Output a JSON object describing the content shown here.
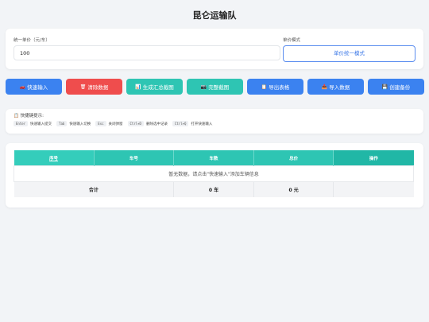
{
  "page": {
    "title": "昆仑运输队"
  },
  "config": {
    "price_label": "统一单价（元/车）",
    "price_value": "100",
    "mode_label": "单价模式",
    "mode_button": "单价统一模式"
  },
  "toolbar": {
    "buttons": [
      {
        "icon": "truck-icon",
        "glyph": "🚗",
        "label": "快速输入",
        "color": "#3b82f0"
      },
      {
        "icon": "trash-icon",
        "glyph": "🗑",
        "label": "清除数据",
        "color": "#ef4d4d"
      },
      {
        "icon": "chart-icon",
        "glyph": "📊",
        "label": "生成汇总截图",
        "color": "#2ec5b3"
      },
      {
        "icon": "camera-icon",
        "glyph": "📷",
        "label": "完整截图",
        "color": "#2ec5b3"
      },
      {
        "icon": "clipboard-icon",
        "glyph": "📋",
        "label": "导出表格",
        "color": "#3b82f0"
      },
      {
        "icon": "inbox-icon",
        "glyph": "📥",
        "label": "导入数据",
        "color": "#3b82f0"
      },
      {
        "icon": "save-icon",
        "glyph": "💾",
        "label": "创建备份",
        "color": "#3b82f0"
      }
    ]
  },
  "tips": {
    "title": "📋 快捷键提示:",
    "shortcuts": [
      {
        "key": "Enter",
        "desc": "快速输入提交"
      },
      {
        "key": "Tab",
        "desc": "快速输入切换"
      },
      {
        "key": "Esc",
        "desc": "关闭弹窗"
      },
      {
        "key": "Ctrl+D",
        "desc": "删除选中记录"
      },
      {
        "key": "Ctrl+Q",
        "desc": "打开快速输入"
      }
    ]
  },
  "table": {
    "headers": [
      "序号",
      "车号",
      "车数",
      "总价",
      "操作"
    ],
    "empty_message": "暂无数据，请点击\"快速输入\"添加车辆信息",
    "totals": {
      "label": "合计",
      "cars": "0 车",
      "price": "0 元"
    }
  }
}
